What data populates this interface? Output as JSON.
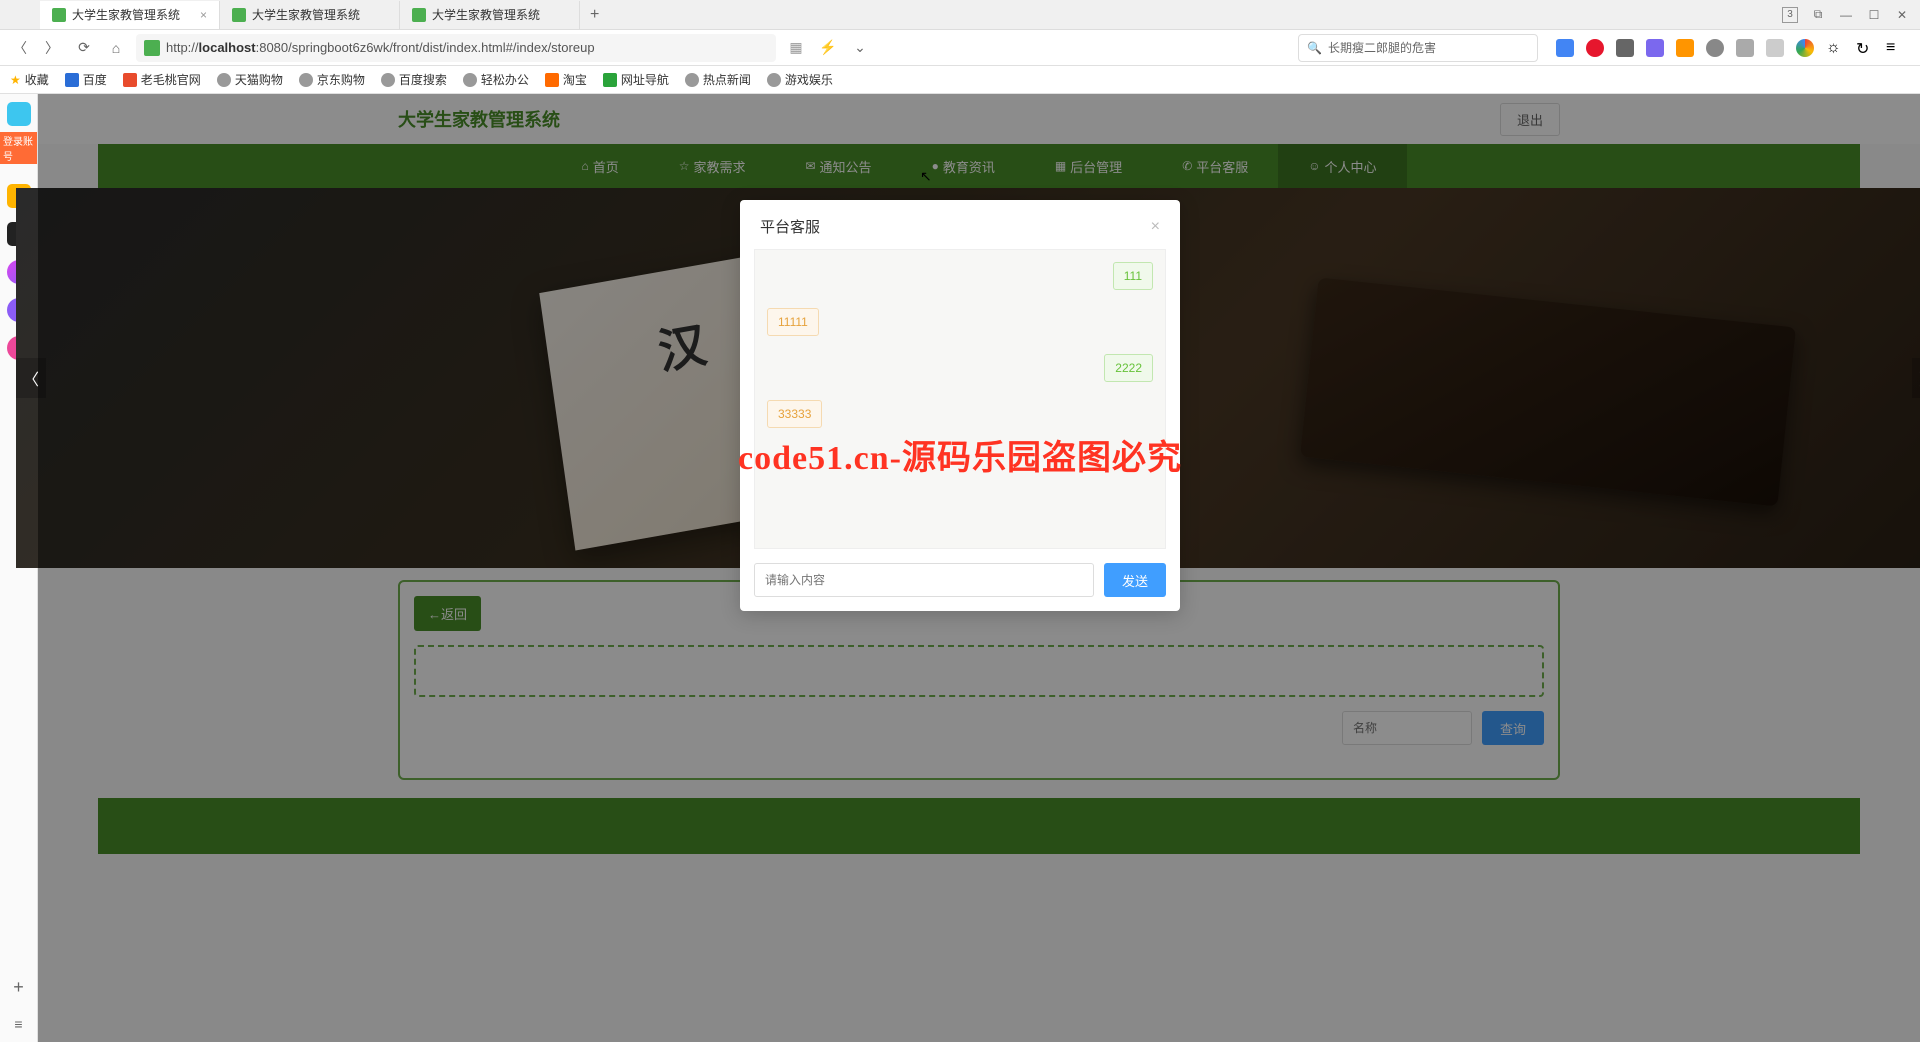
{
  "browser": {
    "tabs": [
      {
        "title": "大学生家教管理系统",
        "active": true
      },
      {
        "title": "大学生家教管理系统",
        "active": false
      },
      {
        "title": "大学生家教管理系统",
        "active": false
      }
    ],
    "tab_count_badge": "3",
    "url_prefix": "http://",
    "url_host": "localhost",
    "url_port": ":8080",
    "url_path": "/springboot6z6wk/front/dist/index.html#/index/storeup",
    "search_placeholder": "长期瘦二郎腿的危害"
  },
  "bookmarks": [
    {
      "label": "收藏",
      "color": "#ffb400"
    },
    {
      "label": "百度",
      "color": "#2a6dd6"
    },
    {
      "label": "老毛桃官网",
      "color": "#e84b2c"
    },
    {
      "label": "天猫购物",
      "color": "#555"
    },
    {
      "label": "京东购物",
      "color": "#555"
    },
    {
      "label": "百度搜索",
      "color": "#555"
    },
    {
      "label": "轻松办公",
      "color": "#555"
    },
    {
      "label": "淘宝",
      "color": "#ff6a00"
    },
    {
      "label": "网址导航",
      "color": "#2aa33a"
    },
    {
      "label": "热点新闻",
      "color": "#555"
    },
    {
      "label": "游戏娱乐",
      "color": "#555"
    }
  ],
  "sidebar": {
    "login_tag": "登录账号",
    "icons": [
      {
        "name": "app-1",
        "color": "#3dc6ef"
      },
      {
        "name": "app-2",
        "color": "#ffb400"
      },
      {
        "name": "app-3",
        "color": "#222"
      },
      {
        "name": "app-4",
        "color": "#d946ef"
      },
      {
        "name": "app-5",
        "color": "#8b5cf6"
      },
      {
        "name": "app-6",
        "color": "#ec4899"
      }
    ]
  },
  "site": {
    "title": "大学生家教管理系统",
    "logout": "退出"
  },
  "nav": [
    {
      "icon": "⌂",
      "label": "首页"
    },
    {
      "icon": "☆",
      "label": "家教需求"
    },
    {
      "icon": "✉",
      "label": "通知公告"
    },
    {
      "icon": "●",
      "label": "教育资讯"
    },
    {
      "icon": "▦",
      "label": "后台管理"
    },
    {
      "icon": "✆",
      "label": "平台客服"
    },
    {
      "icon": "☺",
      "label": "个人中心"
    }
  ],
  "banner": {
    "book_char": "汉"
  },
  "content": {
    "back_label": "←返回",
    "name_placeholder": "名称",
    "query_label": "查询"
  },
  "modal": {
    "title": "平台客服",
    "messages": [
      {
        "side": "right",
        "text": "111"
      },
      {
        "side": "left",
        "text": "11111"
      },
      {
        "side": "right",
        "text": "2222"
      },
      {
        "side": "left",
        "text": "33333"
      }
    ],
    "input_placeholder": "请输入内容",
    "send_label": "发送"
  },
  "watermark": "code51.cn-源码乐园盗图必究"
}
